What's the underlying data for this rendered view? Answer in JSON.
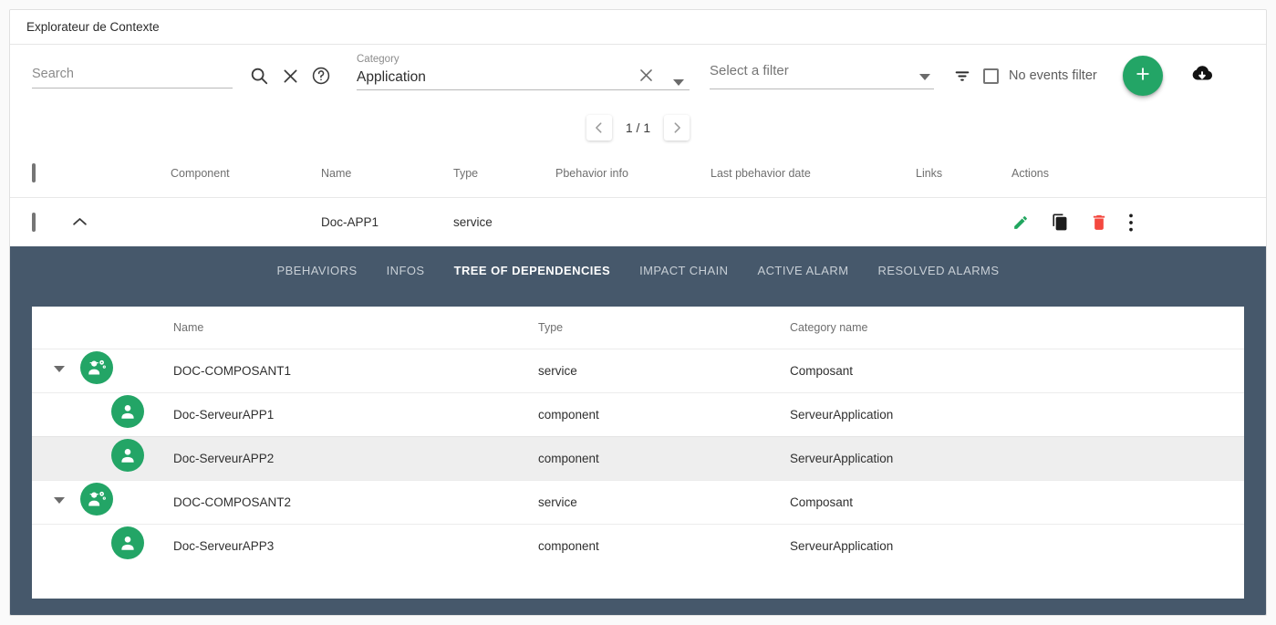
{
  "window": {
    "title": "Explorateur de Contexte"
  },
  "toolbar": {
    "search_placeholder": "Search",
    "search_value": "",
    "search_icon": "search-icon",
    "clear_icon": "close-icon",
    "help_icon": "help-circle-icon",
    "category": {
      "label": "Category",
      "value": "Application",
      "clear_icon": "close-icon",
      "dropdown_icon": "caret-down-icon"
    },
    "filter_select": {
      "placeholder": "Select a filter",
      "dropdown_icon": "caret-down-icon"
    },
    "filter_list_icon": "filter-list-icon",
    "no_events_filter_label": "No events filter",
    "no_events_filter_checked": false,
    "add_button_label": "+",
    "add_button_icon": "plus-icon",
    "download_icon": "cloud-download-icon"
  },
  "pagination": {
    "prev_icon": "chevron-left-icon",
    "next_icon": "chevron-right-icon",
    "page_text": "1 / 1"
  },
  "table": {
    "columns": [
      "Component",
      "Name",
      "Type",
      "Pbehavior info",
      "Last pbehavior date",
      "Links",
      "Actions"
    ],
    "select_all_checked": false,
    "rows": [
      {
        "checked": false,
        "expanded": true,
        "expand_icon": "chevron-up-icon",
        "component": "",
        "name": "Doc-APP1",
        "type": "service",
        "pbehavior_info": "",
        "last_pbehavior_date": "",
        "links": "",
        "actions": [
          {
            "name": "edit-icon",
            "color": "#21a65f"
          },
          {
            "name": "duplicate-icon",
            "color": "#1c1c1c"
          },
          {
            "name": "delete-icon",
            "color": "#f4483f"
          },
          {
            "name": "more-vertical-icon",
            "color": "#1c1c1c"
          }
        ]
      }
    ]
  },
  "tabs": [
    {
      "label": "PBEHAVIORS",
      "active": false
    },
    {
      "label": "INFOS",
      "active": false
    },
    {
      "label": "TREE OF DEPENDENCIES",
      "active": true
    },
    {
      "label": "IMPACT CHAIN",
      "active": false
    },
    {
      "label": "ACTIVE ALARM",
      "active": false
    },
    {
      "label": "RESOLVED ALARMS",
      "active": false
    }
  ],
  "tree": {
    "columns": [
      "Name",
      "Type",
      "Category name"
    ],
    "rows": [
      {
        "name": "DOC-COMPOSANT1",
        "type": "service",
        "category_name": "Composant",
        "level": 0,
        "icon": "engineer-gear-icon",
        "expanded": true,
        "caret_icon": "caret-down-icon",
        "highlighted": false
      },
      {
        "name": "Doc-ServeurAPP1",
        "type": "component",
        "category_name": "ServeurApplication",
        "level": 1,
        "icon": "person-icon",
        "expanded": false,
        "caret_icon": "",
        "highlighted": false
      },
      {
        "name": "Doc-ServeurAPP2",
        "type": "component",
        "category_name": "ServeurApplication",
        "level": 1,
        "icon": "person-icon",
        "expanded": false,
        "caret_icon": "",
        "highlighted": true
      },
      {
        "name": "DOC-COMPOSANT2",
        "type": "service",
        "category_name": "Composant",
        "level": 0,
        "icon": "engineer-gear-icon",
        "expanded": true,
        "caret_icon": "caret-down-icon",
        "highlighted": false
      },
      {
        "name": "Doc-ServeurAPP3",
        "type": "component",
        "category_name": "ServeurApplication",
        "level": 1,
        "icon": "person-icon",
        "expanded": false,
        "caret_icon": "",
        "highlighted": false
      }
    ]
  },
  "colors": {
    "accent_green": "#23a566",
    "tab_bar": "#46586b",
    "delete_red": "#f4483f",
    "edit_green": "#21a65f",
    "row_highlight": "#eeeeee"
  }
}
